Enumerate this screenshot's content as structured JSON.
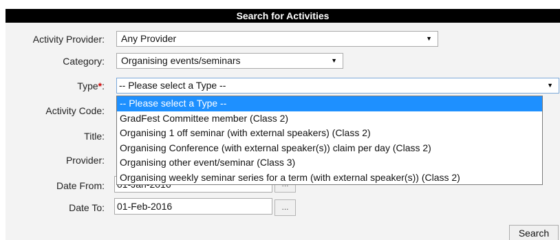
{
  "header": {
    "title": "Search for Activities"
  },
  "form": {
    "provider_label": "Activity Provider:",
    "provider_value": "Any Provider",
    "category_label": "Category:",
    "category_value": "Organising events/seminars",
    "type_label": "Type",
    "type_required_mark": "*",
    "type_colon": ":",
    "type_value": "-- Please select a Type --",
    "code_label": "Activity Code:",
    "title_label": "Title:",
    "provider_text_label": "Provider:",
    "date_from_label": "Date From:",
    "date_from_value": "01-Jan-2016",
    "date_to_label": "Date To:",
    "date_to_value": "01-Feb-2016",
    "date_button_label": "...",
    "search_button": "Search"
  },
  "type_dropdown": {
    "options": [
      "-- Please select a Type --",
      "GradFest Committee member (Class 2)",
      "Organising 1 off seminar (with external speakers) (Class 2)",
      "Organising Conference (with external speaker(s)) claim per day (Class 2)",
      "Organising other event/seminar (Class 3)",
      "Organising weekly seminar series for a term (with external speaker(s)) (Class 2)"
    ],
    "highlighted_index": 0
  },
  "icons": {
    "select_arrow": "dropdown-arrow-icon"
  },
  "colors": {
    "header_bg": "#000000",
    "highlight": "#1e90ff",
    "required": "#cc0000"
  }
}
